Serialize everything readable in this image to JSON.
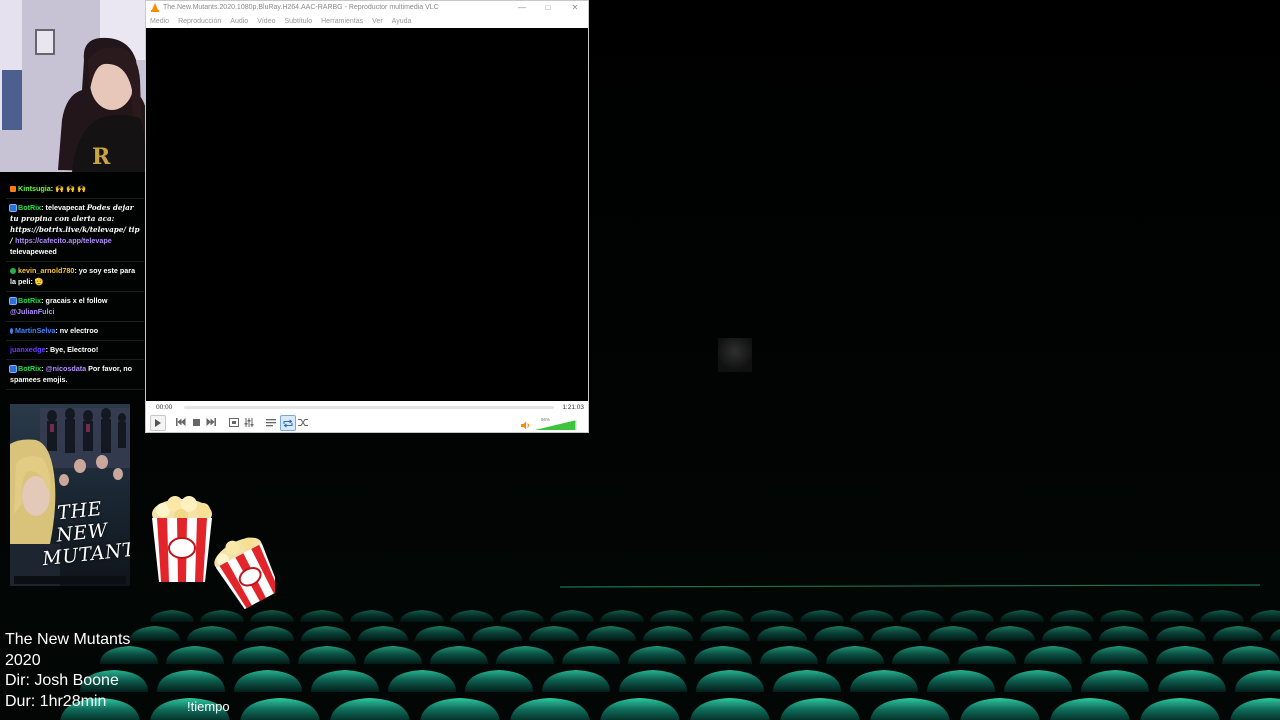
{
  "vlc": {
    "title": "The.New.Mutants.2020.1080p.BluRay.H264.AAC-RARBG - Reproductor multimedia VLC",
    "menu": [
      "Medio",
      "Reproducción",
      "Audio",
      "Vídeo",
      "Subtítulo",
      "Herramientas",
      "Ver",
      "Ayuda"
    ],
    "time_current": "00:00",
    "time_total": "1:21:03",
    "volume_percent": "96%",
    "volume_level": 0.96,
    "progress": 0
  },
  "chat": {
    "messages": [
      {
        "badge": "orange",
        "user": "Kintsugia",
        "user_color": "#6cff3a",
        "text": ": 🙌 🙌 🙌"
      },
      {
        "badge": "blue",
        "user": "BotRix",
        "user_color": "#27e14b",
        "text": ": televapecat ",
        "extra_italic": "Podes dejar tu propina con alerta aca: https://botrix.live/k/televape/ tip / ",
        "link": "https://cafecito.app/televape",
        "tail": " televapeweed"
      },
      {
        "badge": "green",
        "user": "kevin_arnold780",
        "user_color": "#f7c633",
        "text": ": yo soy este para la peli: 🫡"
      },
      {
        "badge": "blue",
        "user": "BotRix",
        "user_color": "#27e14b",
        "text": ": gracais x el follow ",
        "mention": "@JulianFulci"
      },
      {
        "badge": "none-dot",
        "user": "MartinSelva",
        "user_color": "#3f86ff",
        "text": ": nv electroo"
      },
      {
        "badge": "none",
        "user": "juanxedge",
        "user_color": "#6b3cff",
        "text": ": Bye, Electroo!"
      },
      {
        "badge": "blue",
        "user": "BotRix",
        "user_color": "#27e14b",
        "text": ": ",
        "mention": "@nicosdata",
        "tail": " Por favor, no spamees emojis."
      }
    ]
  },
  "poster": {
    "title": "THE NEW MUTANTS"
  },
  "info": {
    "title": "The New Mutants",
    "year": "2020",
    "director": "Dir: Josh Boone",
    "duration": "Dur: 1hr28min"
  },
  "command": "!tiempo",
  "colors": {
    "seats": "#0e6b5e",
    "seat_highlight": "#1fae8e",
    "vlc_accent": "#ff8800"
  }
}
